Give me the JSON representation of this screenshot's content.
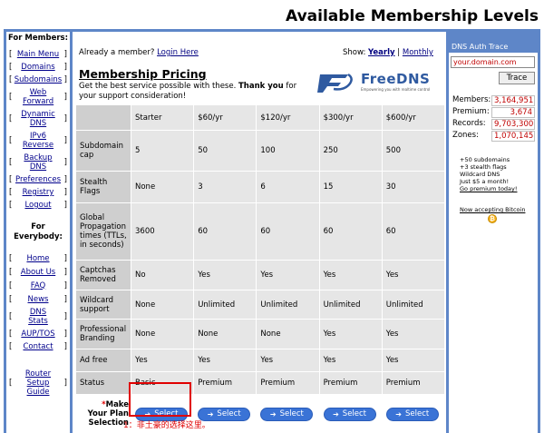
{
  "page": {
    "title": "Available Membership Levels"
  },
  "sidebar": {
    "members_heading": "For Members:",
    "member_links": [
      {
        "label": "Main Menu"
      },
      {
        "label": "Domains"
      },
      {
        "label": "Subdomains"
      },
      {
        "label": "Web Forward"
      },
      {
        "label": "Dynamic DNS"
      },
      {
        "label": "IPv6 Reverse"
      },
      {
        "label": "Backup DNS"
      },
      {
        "label": "Preferences"
      },
      {
        "label": "Registry"
      },
      {
        "label": "Logout"
      }
    ],
    "everybody_heading": "For Everybody:",
    "everybody_links": [
      {
        "label": "Home"
      },
      {
        "label": "About Us"
      },
      {
        "label": "FAQ"
      },
      {
        "label": "News"
      },
      {
        "label": "DNS Stats"
      },
      {
        "label": "AUP/TOS"
      },
      {
        "label": "Contact"
      }
    ],
    "router_link": "Router Setup Guide"
  },
  "main": {
    "already_member": "Already a member?",
    "login_link": "Login Here",
    "show_label": "Show:",
    "show_yearly": "Yearly",
    "show_separator": "|",
    "show_monthly": "Monthly",
    "pricing_title": "Membership Pricing",
    "pricing_sub_1": "Get the best service possible with these.",
    "pricing_sub_bold": "Thank you",
    "pricing_sub_2": "for your support consideration!",
    "logo_word": "FreeDNS",
    "logo_tagline": "Empowering you with realtime control"
  },
  "plans": {
    "columns": [
      "Starter",
      "$60/yr",
      "$120/yr",
      "$300/yr",
      "$600/yr"
    ],
    "rows": [
      {
        "label": "Subdomain cap",
        "values": [
          "5",
          "50",
          "100",
          "250",
          "500"
        ]
      },
      {
        "label": "Stealth Flags",
        "values": [
          "None",
          "3",
          "6",
          "15",
          "30"
        ]
      },
      {
        "label": "Global Propagation times (TTLs, in seconds)",
        "values": [
          "3600",
          "60",
          "60",
          "60",
          "60"
        ]
      },
      {
        "label": "Captchas Removed",
        "values": [
          "No",
          "Yes",
          "Yes",
          "Yes",
          "Yes"
        ]
      },
      {
        "label": "Wildcard support",
        "values": [
          "None",
          "Unlimited",
          "Unlimited",
          "Unlimited",
          "Unlimited"
        ]
      },
      {
        "label": "Professional Branding",
        "values": [
          "None",
          "None",
          "None",
          "Yes",
          "Yes"
        ]
      },
      {
        "label": "Ad free",
        "values": [
          "Yes",
          "Yes",
          "Yes",
          "Yes",
          "Yes"
        ]
      },
      {
        "label": "Status",
        "values": [
          "Basic",
          "Premium",
          "Premium",
          "Premium",
          "Premium"
        ]
      }
    ],
    "selection_asterisk": "*",
    "selection_label": "Make Your Plan Selection",
    "select_button": "Select",
    "select_arrow": "➔"
  },
  "annotation": {
    "text": "1：非土豪的选择这里。",
    "color": "#e00000"
  },
  "right_panel": {
    "auth_title": "DNS Auth Trace",
    "auth_input": "your.domain.com",
    "trace_button": "Trace",
    "stats": [
      {
        "label": "Members:",
        "value": "3,164,951"
      },
      {
        "label": "Premium:",
        "value": "3,674"
      },
      {
        "label": "Records:",
        "value": "9,703,300"
      },
      {
        "label": "Zones:",
        "value": "1,070,145"
      }
    ],
    "promo_lines": [
      "+50 subdomains",
      "+3 stealth flags",
      "Wildcard DNS",
      "Just $5 a month!"
    ],
    "promo_link": "Go premium today!",
    "bitcoin_link": "Now accepting Bitcoin"
  },
  "colors": {
    "frame": "#5e86c8",
    "button": "#3a73d6",
    "highlight": "#e00000",
    "stat_value": "#c00000"
  }
}
